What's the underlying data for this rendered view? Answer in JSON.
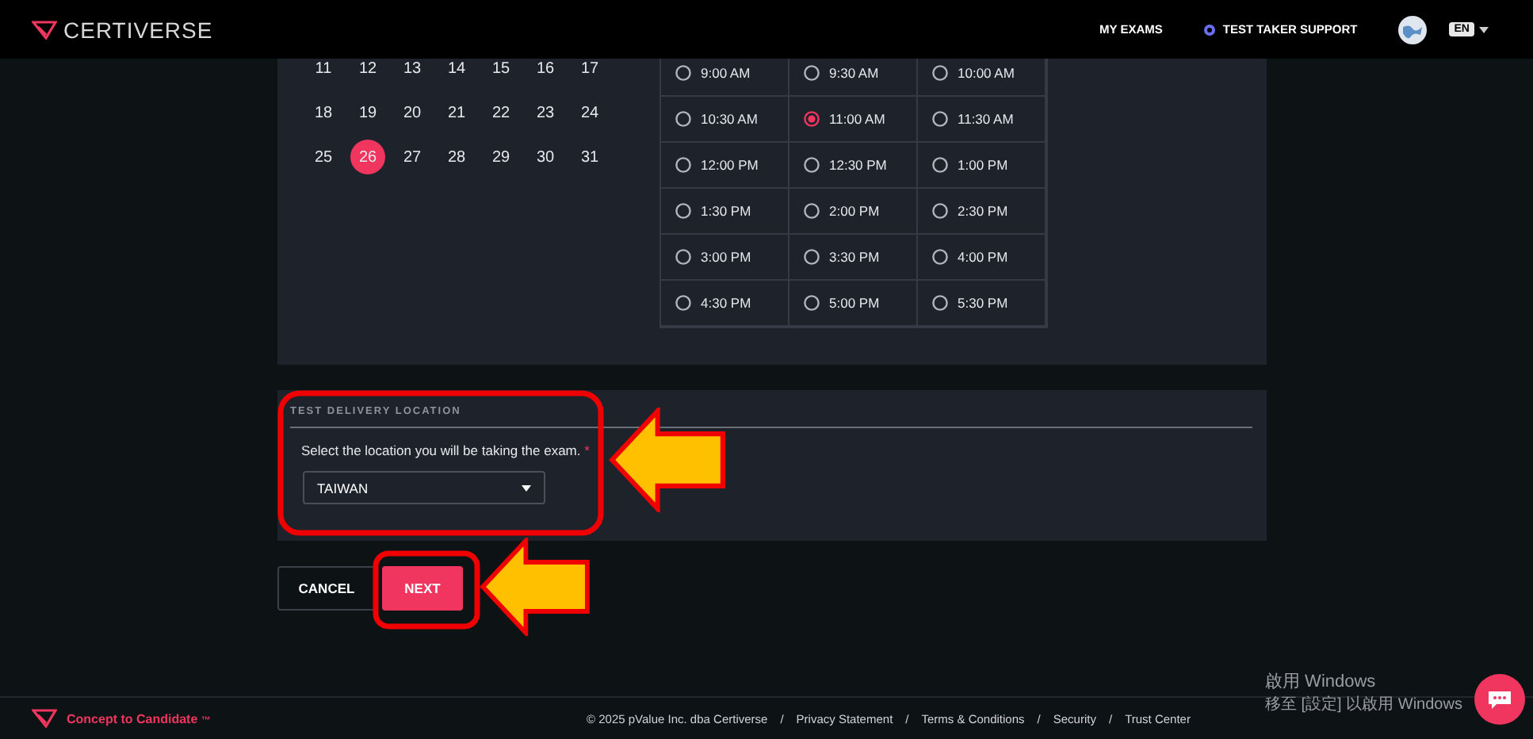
{
  "header": {
    "brand": "CERTIVERSE",
    "nav": [
      {
        "label": "MY EXAMS",
        "kind": "link"
      },
      {
        "label": "TEST TAKER SUPPORT",
        "kind": "support"
      }
    ],
    "language": "EN"
  },
  "calendar": {
    "weeks": [
      [
        {
          "label": "11",
          "selected": false
        },
        {
          "label": "12",
          "selected": false
        },
        {
          "label": "13",
          "selected": false
        },
        {
          "label": "14",
          "selected": false
        },
        {
          "label": "15",
          "selected": false
        },
        {
          "label": "16",
          "selected": false
        },
        {
          "label": "17",
          "selected": false
        }
      ],
      [
        {
          "label": "18",
          "selected": false
        },
        {
          "label": "19",
          "selected": false
        },
        {
          "label": "20",
          "selected": false
        },
        {
          "label": "21",
          "selected": false
        },
        {
          "label": "22",
          "selected": false
        },
        {
          "label": "23",
          "selected": false
        },
        {
          "label": "24",
          "selected": false
        }
      ],
      [
        {
          "label": "25",
          "selected": false
        },
        {
          "label": "26",
          "selected": true
        },
        {
          "label": "27",
          "selected": false
        },
        {
          "label": "28",
          "selected": false
        },
        {
          "label": "29",
          "selected": false
        },
        {
          "label": "30",
          "selected": false
        },
        {
          "label": "31",
          "selected": false
        }
      ]
    ]
  },
  "time_slots": [
    {
      "label": "9:00 AM",
      "selected": false
    },
    {
      "label": "9:30 AM",
      "selected": false
    },
    {
      "label": "10:00 AM",
      "selected": false
    },
    {
      "label": "10:30 AM",
      "selected": false
    },
    {
      "label": "11:00 AM",
      "selected": true
    },
    {
      "label": "11:30 AM",
      "selected": false
    },
    {
      "label": "12:00 PM",
      "selected": false
    },
    {
      "label": "12:30 PM",
      "selected": false
    },
    {
      "label": "1:00 PM",
      "selected": false
    },
    {
      "label": "1:30 PM",
      "selected": false
    },
    {
      "label": "2:00 PM",
      "selected": false
    },
    {
      "label": "2:30 PM",
      "selected": false
    },
    {
      "label": "3:00 PM",
      "selected": false
    },
    {
      "label": "3:30 PM",
      "selected": false
    },
    {
      "label": "4:00 PM",
      "selected": false
    },
    {
      "label": "4:30 PM",
      "selected": false
    },
    {
      "label": "5:00 PM",
      "selected": false
    },
    {
      "label": "5:30 PM",
      "selected": false
    }
  ],
  "location": {
    "title": "TEST DELIVERY LOCATION",
    "prompt": "Select the location you will be taking the exam.",
    "required_mark": "*",
    "value": "TAIWAN"
  },
  "buttons": {
    "cancel": "CANCEL",
    "next": "NEXT"
  },
  "footer": {
    "tagline": "Concept to Candidate",
    "trademark": "™",
    "items": [
      "© 2025 pValue Inc. dba Certiverse",
      "/",
      "Privacy Statement",
      "/",
      "Terms & Conditions",
      "/",
      "Security",
      "/",
      "Trust Center"
    ]
  },
  "os_notice": {
    "title": "啟用 Windows",
    "text": "移至 [設定] 以啟用 Windows"
  }
}
